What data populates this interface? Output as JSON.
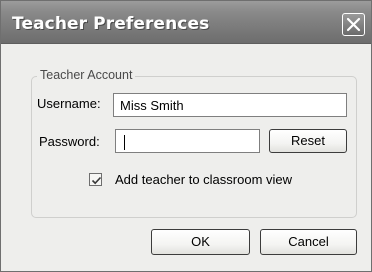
{
  "window": {
    "title": "Teacher Preferences"
  },
  "group": {
    "legend": "Teacher Account"
  },
  "username": {
    "label": "Username:",
    "value": "Miss Smith"
  },
  "password": {
    "label": "Password:",
    "value": ""
  },
  "reset_button": {
    "label": "Reset"
  },
  "checkbox": {
    "label": "Add teacher to classroom view",
    "checked": true
  },
  "ok_button": {
    "label": "OK"
  },
  "cancel_button": {
    "label": "Cancel"
  },
  "icons": {
    "close": "close-icon",
    "check": "checkmark-icon"
  }
}
